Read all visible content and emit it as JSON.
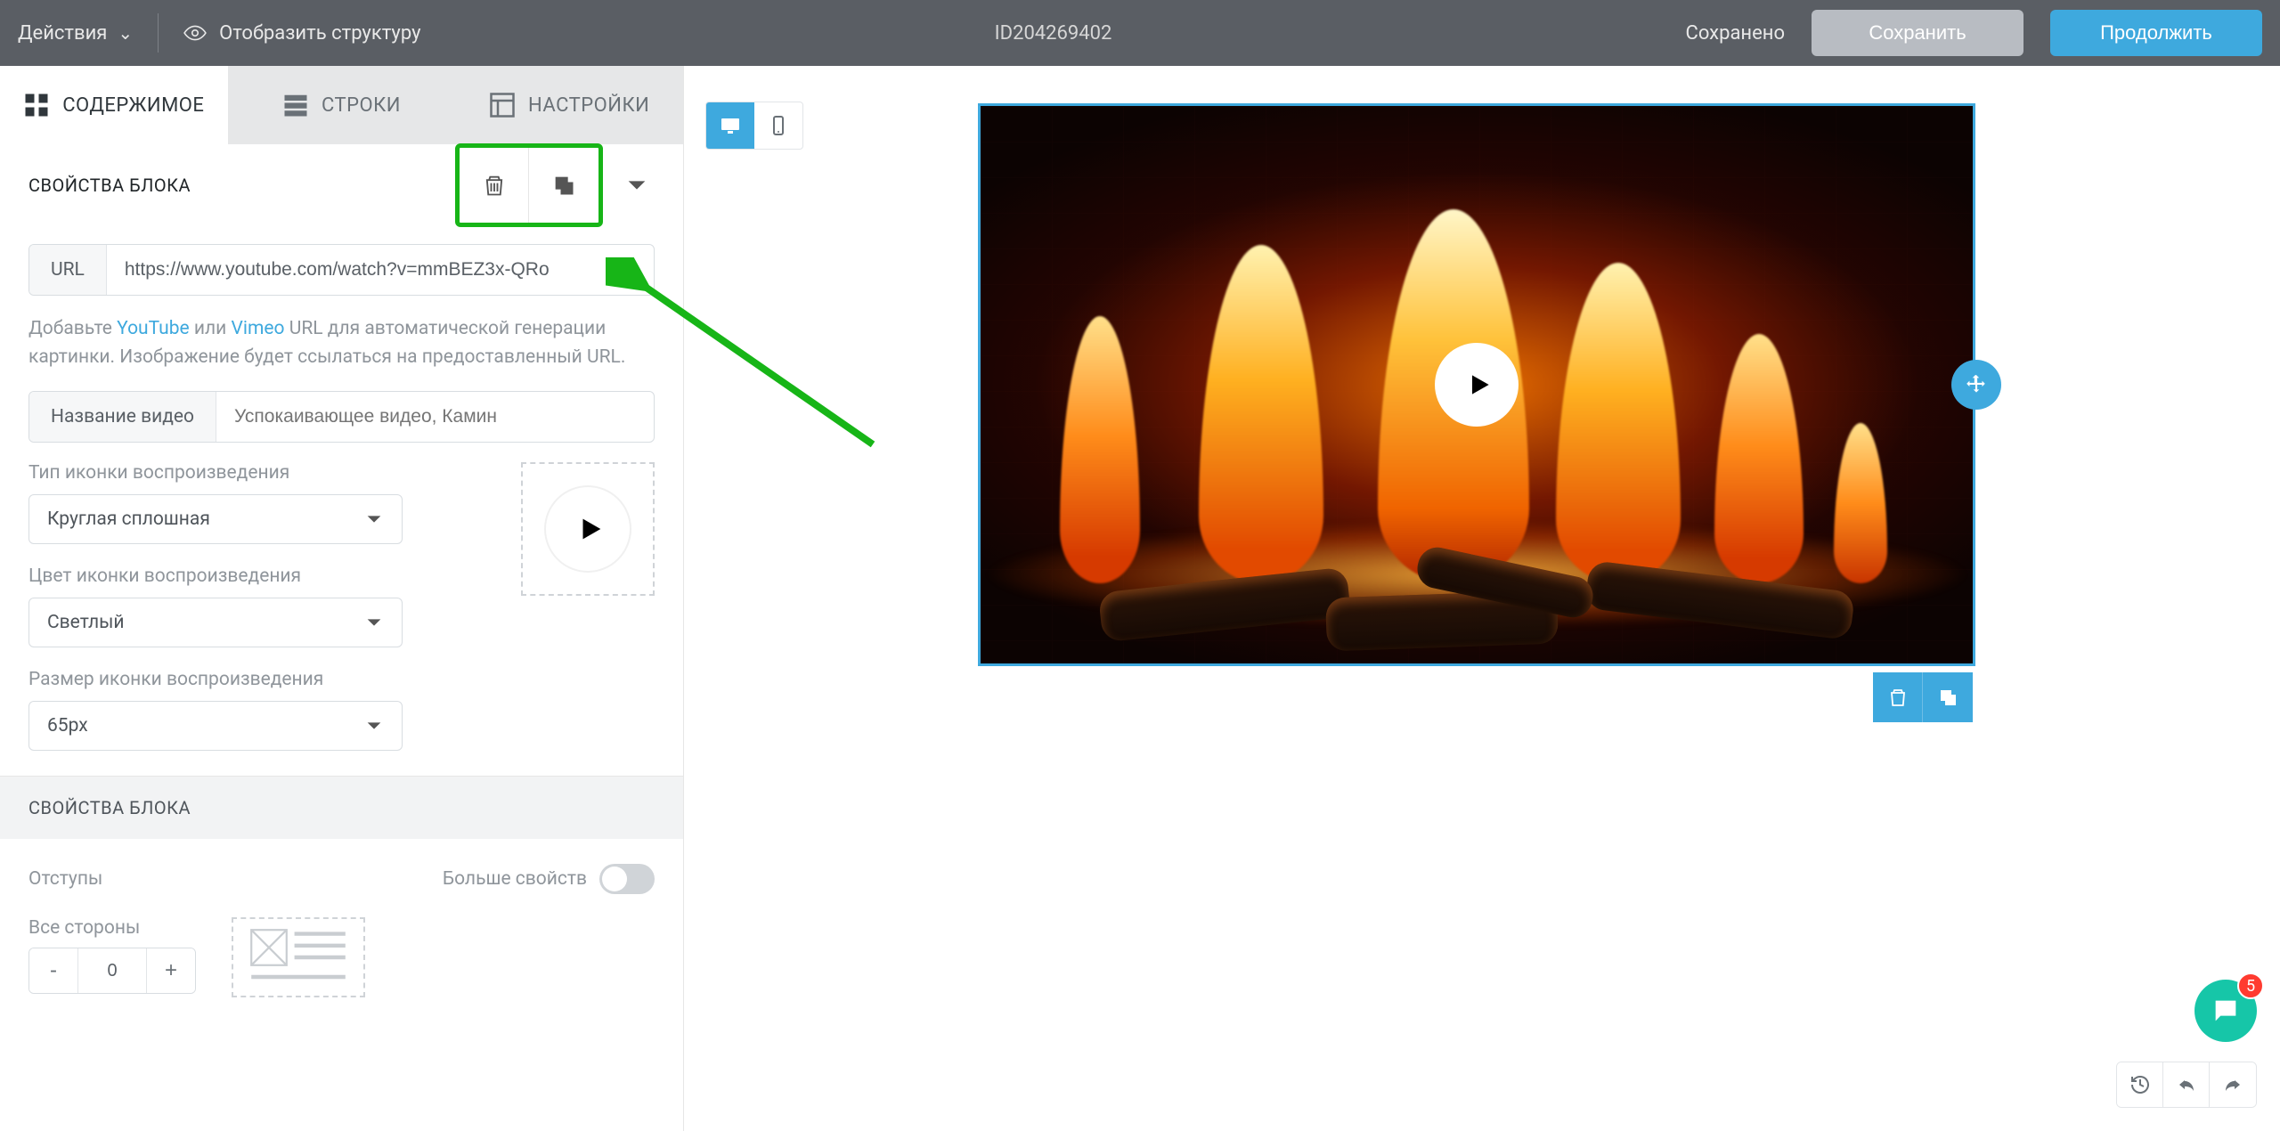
{
  "topbar": {
    "actions": "Действия",
    "show_structure": "Отобразить структуру",
    "doc_id": "ID204269402",
    "saved": "Сохранено",
    "save": "Сохранить",
    "continue": "Продолжить"
  },
  "tabs": {
    "content": "СОДЕРЖИМОЕ",
    "rows": "СТРОКИ",
    "settings": "НАСТРОЙКИ"
  },
  "block": {
    "header": "СВОЙСТВА БЛОКА",
    "url_label": "URL",
    "url_value": "https://www.youtube.com/watch?v=mmBEZ3x-QRo",
    "help_pre": "Добавьте ",
    "help_youtube": "YouTube",
    "help_or": " или ",
    "help_vimeo": "Vimeo",
    "help_post": " URL для автоматической генерации картинки. Изображение будет ссылаться на предоставленный URL.",
    "title_label": "Название видео",
    "title_placeholder": "Успокаивающее видео, Камин",
    "icon_type_label": "Тип иконки воспроизведения",
    "icon_type_value": "Круглая сплошная",
    "icon_color_label": "Цвет иконки воспроизведения",
    "icon_color_value": "Светлый",
    "icon_size_label": "Размер иконки воспроизведения",
    "icon_size_value": "65px"
  },
  "block_props2": {
    "header": "СВОЙСТВА БЛОКА",
    "padding_label": "Отступы",
    "more_label": "Больше свойств",
    "all_sides_label": "Все стороны",
    "pad_value": "0"
  },
  "chat": {
    "badge": "5"
  }
}
